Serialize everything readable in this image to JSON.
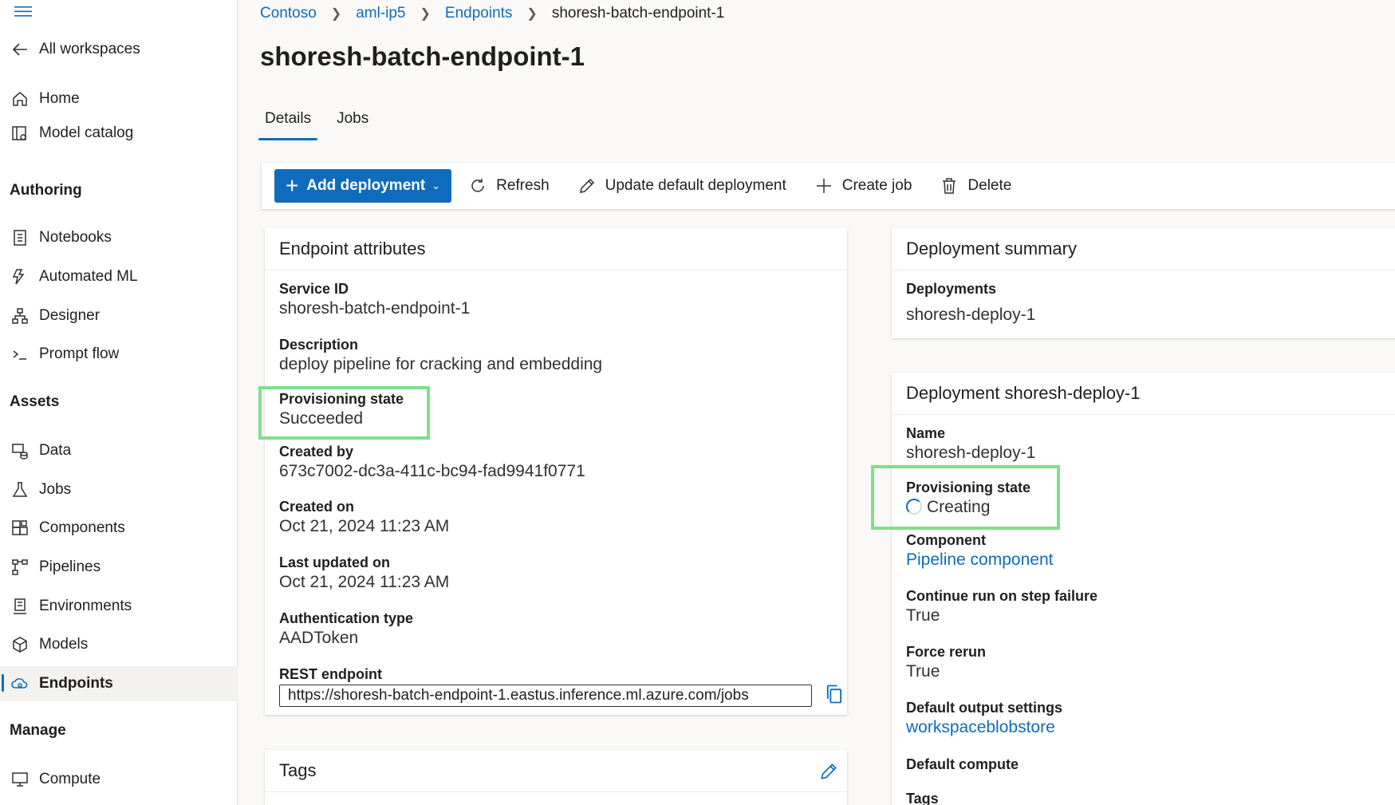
{
  "sidebar": {
    "back_label": "All workspaces",
    "top_items": [
      {
        "label": "Home",
        "icon": "home-icon"
      },
      {
        "label": "Model catalog",
        "icon": "book-icon"
      }
    ],
    "sections": {
      "authoring": "Authoring",
      "assets": "Assets",
      "manage": "Manage"
    },
    "authoring_items": [
      {
        "label": "Notebooks",
        "icon": "notebook-icon"
      },
      {
        "label": "Automated ML",
        "icon": "flash-icon"
      },
      {
        "label": "Designer",
        "icon": "designer-icon"
      },
      {
        "label": "Prompt flow",
        "icon": "terminal-icon"
      }
    ],
    "asset_items": [
      {
        "label": "Data",
        "icon": "data-icon"
      },
      {
        "label": "Jobs",
        "icon": "flask-icon"
      },
      {
        "label": "Components",
        "icon": "components-icon"
      },
      {
        "label": "Pipelines",
        "icon": "pipelines-icon"
      },
      {
        "label": "Environments",
        "icon": "environments-icon"
      },
      {
        "label": "Models",
        "icon": "cube-icon"
      },
      {
        "label": "Endpoints",
        "icon": "endpoints-icon",
        "active": true
      }
    ],
    "manage_items": [
      {
        "label": "Compute",
        "icon": "monitor-icon"
      }
    ]
  },
  "breadcrumb": [
    "Contoso",
    "aml-ip5",
    "Endpoints",
    "shoresh-batch-endpoint-1"
  ],
  "page_title": "shoresh-batch-endpoint-1",
  "tabs": [
    {
      "label": "Details",
      "active": true
    },
    {
      "label": "Jobs",
      "active": false
    }
  ],
  "toolbar": {
    "add_deployment": "Add deployment",
    "refresh": "Refresh",
    "update_default": "Update default deployment",
    "create_job": "Create job",
    "delete": "Delete"
  },
  "endpoint_attributes": {
    "title": "Endpoint attributes",
    "service_id_label": "Service ID",
    "service_id": "shoresh-batch-endpoint-1",
    "description_label": "Description",
    "description": "deploy pipeline for cracking and embedding",
    "provisioning_label": "Provisioning state",
    "provisioning": "Succeeded",
    "created_by_label": "Created by",
    "created_by": "673c7002-dc3a-411c-bc94-fad9941f0771",
    "created_on_label": "Created on",
    "created_on": "Oct 21, 2024 11:23 AM",
    "updated_label": "Last updated on",
    "updated": "Oct 21, 2024 11:23 AM",
    "auth_label": "Authentication type",
    "auth": "AADToken",
    "rest_label": "REST endpoint",
    "rest": "https://shoresh-batch-endpoint-1.eastus.inference.ml.azure.com/jobs"
  },
  "tags_card": {
    "title": "Tags"
  },
  "deployment_summary": {
    "title": "Deployment summary",
    "deployments_label": "Deployments",
    "deployment": "shoresh-deploy-1"
  },
  "deployment_detail": {
    "title": "Deployment shoresh-deploy-1",
    "name_label": "Name",
    "name": "shoresh-deploy-1",
    "provisioning_label": "Provisioning state",
    "provisioning": "Creating",
    "component_label": "Component",
    "component": "Pipeline component",
    "continue_label": "Continue run on step failure",
    "continue": "True",
    "force_label": "Force rerun",
    "force": "True",
    "output_label": "Default output settings",
    "output": "workspaceblobstore",
    "compute_label": "Default compute",
    "tags_label": "Tags"
  },
  "colors": {
    "accent": "#0f6cbd",
    "highlight": "#7ee08a"
  }
}
